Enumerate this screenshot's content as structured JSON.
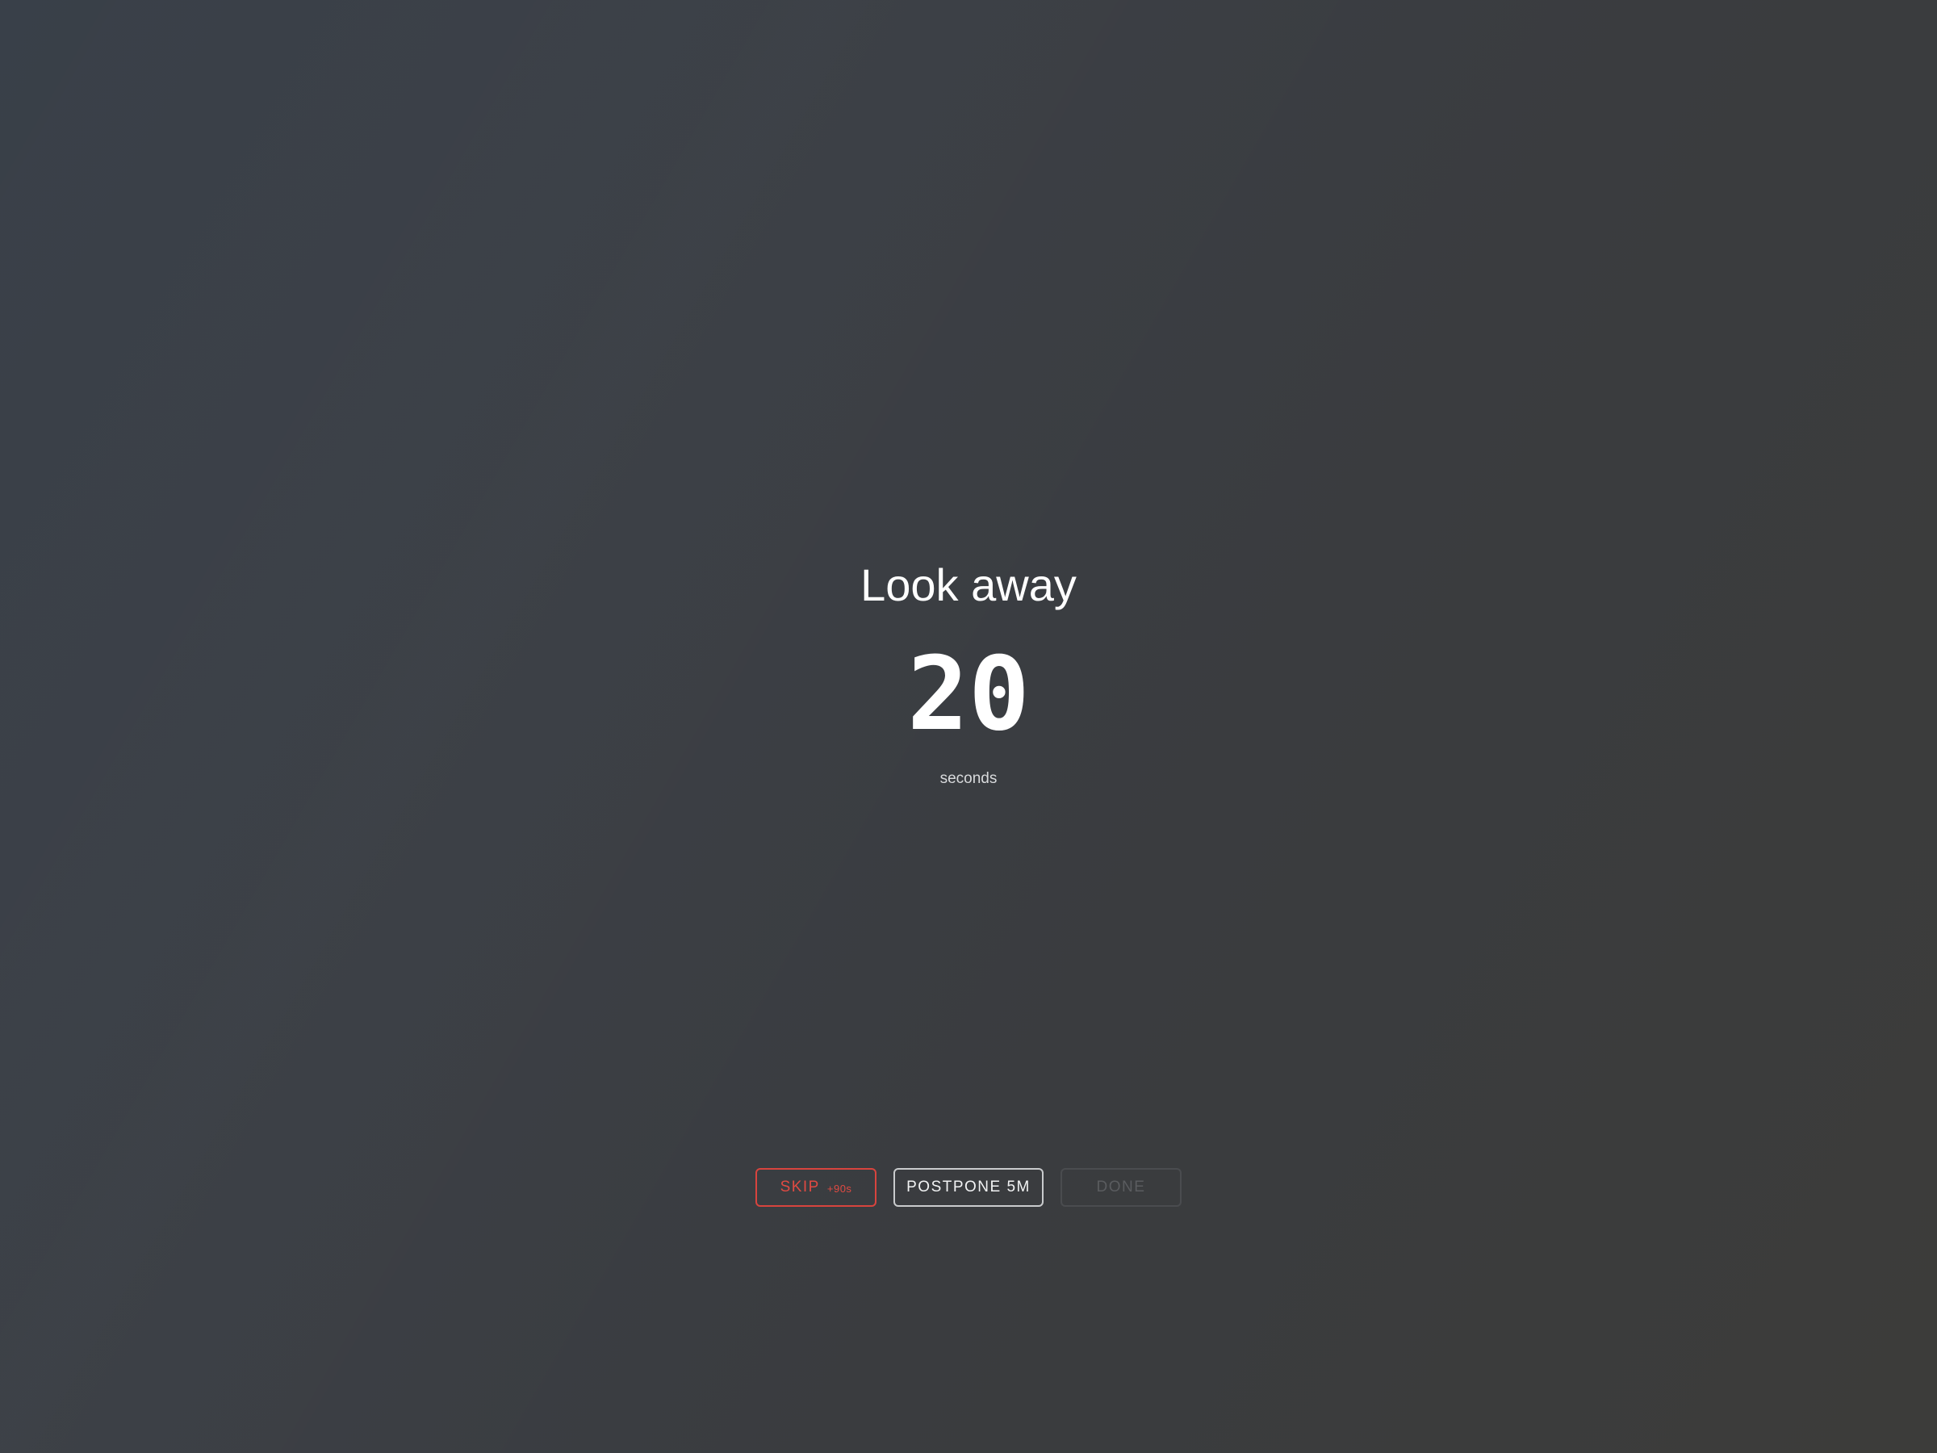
{
  "overlay": {
    "title": "Look away",
    "countdown": "20",
    "unit": "seconds"
  },
  "actions": {
    "skip_label": "SKIP",
    "skip_sub": "+90s",
    "postpone_label": "POSTPONE 5M",
    "done_label": "DONE"
  },
  "colors": {
    "skip_accent": "#e04a42",
    "background": "#393c41"
  }
}
